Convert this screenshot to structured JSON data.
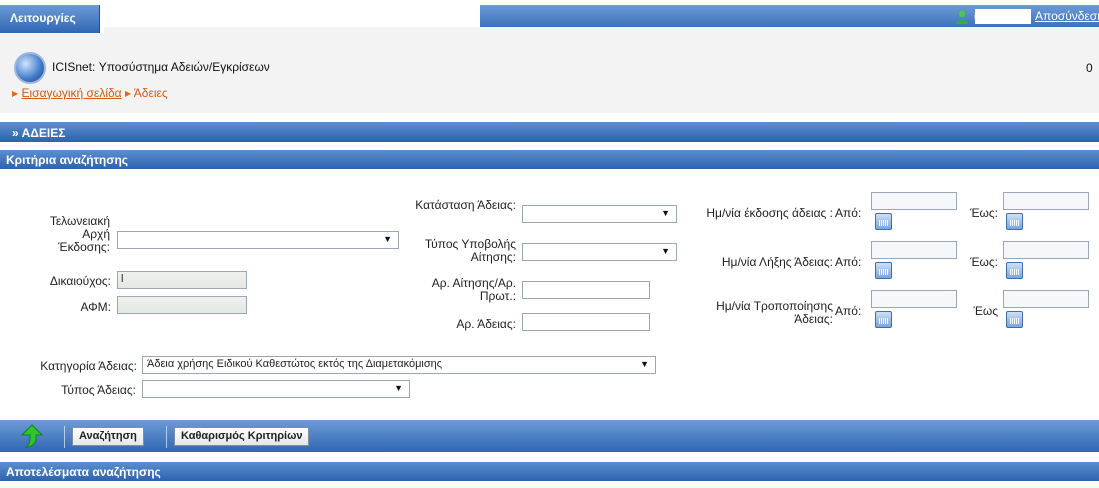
{
  "menu": {
    "label": "Λειτουργίες"
  },
  "user": {
    "paren": "(",
    "name_redacted": "",
    "logout_label": "Αποσύνδεση"
  },
  "header": {
    "app_title": "ICISnet: Υποσύστημα Αδειών/Εγκρίσεων",
    "count": "0",
    "breadcrumb": {
      "home": "Εισαγωγική σελίδα",
      "current": "Άδειες"
    }
  },
  "sections": {
    "adeies": "» ΑΔΕΙΕΣ",
    "criteria": "Κριτήρια αναζήτησης",
    "results": "Αποτελέσματα αναζήτησης"
  },
  "form": {
    "customs_office_label": "Τελωνειακή Αρχή Έκδοσης:",
    "customs_office_value": "",
    "holder_label": "Δικαιούχος:",
    "holder_value": "l",
    "afm_label": "ΑΦΜ:",
    "afm_value": "",
    "license_status_label": "Κατάσταση Άδειας:",
    "license_status_value": "",
    "submission_type_label": "Τύπος Υποβολής Αίτησης:",
    "submission_type_value": "",
    "application_no_label": "Αρ. Αίτησης/Αρ. Πρωτ.:",
    "license_no_label": "Αρ. Άδειας:",
    "issue_date_label": "Ημ/νία έκδοσης άδειας :",
    "expiry_date_label": "Ημ/νία Λήξης Άδειας:",
    "modification_date_label": "Ημ/νία Τροποποίησης Άδειας:",
    "from_label": "Από:",
    "to_label": "Έως:",
    "to_label_no_colon": "Έως",
    "category_label": "Κατηγορία Άδειας:",
    "category_value": "Άδεια χρήσης Ειδικού Καθεστώτος εκτός της Διαμετακόμισης",
    "type_label": "Τύπος Άδειας:",
    "type_value": ""
  },
  "toolbar": {
    "search_label": "Αναζήτηση",
    "clear_label": "Καθαρισμός Κριτηρίων"
  },
  "colors": {
    "bar": "#2f66b4",
    "link": "#d55a12",
    "accent_green": "#2fb52f"
  }
}
